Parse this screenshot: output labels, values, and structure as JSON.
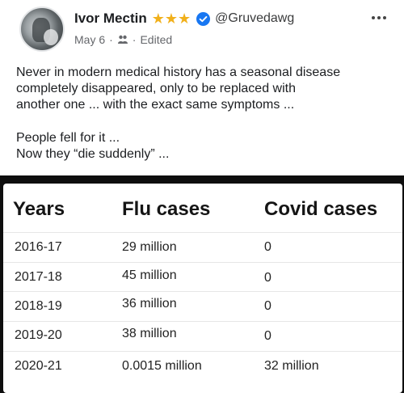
{
  "post": {
    "author": "Ivor Mectin",
    "stars": "★★★",
    "handle": "@Gruvedawg",
    "date": "May 6",
    "separator": "·",
    "edited": "Edited",
    "body_lines": [
      "Never in modern medical history has a seasonal disease",
      "completely disappeared, only to be replaced with",
      "another one ... with the exact same symptoms ..."
    ],
    "body_lines_2": [
      "People fell for it ...",
      "Now they “die suddenly” ..."
    ]
  },
  "table": {
    "headers": [
      "Years",
      "Flu cases",
      "Covid cases"
    ],
    "rows": [
      [
        "2016-17",
        "29 million",
        "0"
      ],
      [
        "2017-18",
        "45 million",
        "0"
      ],
      [
        "2018-19",
        "36 million",
        "0"
      ],
      [
        "2019-20",
        "38 million",
        "0"
      ],
      [
        "2020-21",
        "0.0015 million",
        "32 million"
      ]
    ]
  },
  "colors": {
    "stars": "#f1b01b",
    "verified": "#1877f2",
    "panel_bg": "#0e0e0e"
  },
  "icons": {
    "verified": "verified-badge-icon",
    "audience": "audience-icon",
    "more": "more-options-icon"
  }
}
